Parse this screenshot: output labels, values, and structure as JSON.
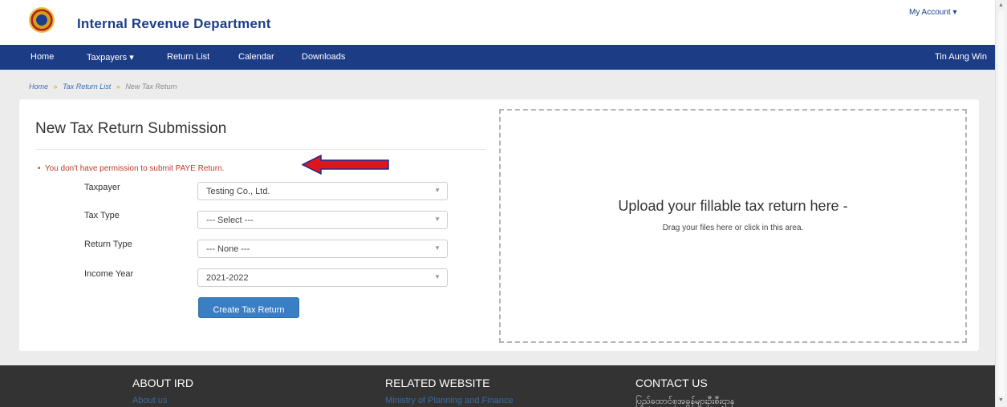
{
  "header": {
    "brand": "Internal Revenue Department",
    "my_account": "My Account ▾"
  },
  "navbar": {
    "items": [
      "Home",
      "Taxpayers ▾",
      "Return List",
      "Calendar",
      "Downloads"
    ],
    "user": "Tin Aung Win"
  },
  "breadcrumb": {
    "home": "Home",
    "list": "Tax Return List",
    "current": "New Tax Return",
    "separator": "»"
  },
  "form": {
    "title": "New Tax Return Submission",
    "error": "You don't have permission to submit PAYE Return.",
    "fields": [
      {
        "label": "Taxpayer",
        "value": "Testing Co., Ltd."
      },
      {
        "label": "Tax Type",
        "value": "--- Select ---"
      },
      {
        "label": "Return Type",
        "value": "--- None ---"
      },
      {
        "label": "Income Year",
        "value": "2021-2022"
      }
    ],
    "submit_label": "Create Tax Return"
  },
  "dropzone": {
    "title": "Upload your fillable tax return here -",
    "subtitle": "Drag your files here or click in this area."
  },
  "footer": {
    "about_heading": "ABOUT IRD",
    "about_link": "About us",
    "related_heading": "RELATED WEBSITE",
    "related_link": "Ministry of Planning and Finance",
    "contact_heading": "CONTACT US",
    "contact_text": "ပြည်ထောင်စုအခွန်များဦးစီးဌာန"
  },
  "colors": {
    "brand_blue": "#1d3c86",
    "error_red": "#c0392b",
    "button_blue": "#3a7ec4",
    "footer_bg": "#333333"
  }
}
